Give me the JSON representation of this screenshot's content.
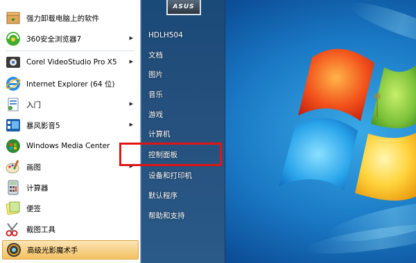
{
  "left_pane": {
    "items": [
      {
        "label": "强力卸载电脑上的软件",
        "icon": "uninstall-box-icon",
        "has_arrow": false
      },
      {
        "label": "360安全浏览器7",
        "icon": "browser-360-icon",
        "has_arrow": true
      },
      {
        "label": "Corel VideoStudio Pro X5",
        "icon": "corel-videostudio-icon",
        "has_arrow": true
      },
      {
        "label": "Internet Explorer (64 位)",
        "icon": "internet-explorer-icon",
        "has_arrow": false
      },
      {
        "label": "入门",
        "icon": "getting-started-icon",
        "has_arrow": true
      },
      {
        "label": "暴风影音5",
        "icon": "baofeng-player-icon",
        "has_arrow": true
      },
      {
        "label": "Windows Media Center",
        "icon": "windows-media-center-icon",
        "has_arrow": false
      },
      {
        "label": "画图",
        "icon": "paint-icon",
        "has_arrow": true
      },
      {
        "label": "计算器",
        "icon": "calculator-icon",
        "has_arrow": false
      },
      {
        "label": "便签",
        "icon": "sticky-notes-icon",
        "has_arrow": false
      },
      {
        "label": "截图工具",
        "icon": "snipping-tool-icon",
        "has_arrow": false
      },
      {
        "label": "高级光影魔术手",
        "icon": "nEO-imaging-icon",
        "has_arrow": false,
        "highlighted": true
      }
    ]
  },
  "user_picture": {
    "brand_text": "ASUS"
  },
  "right_pane": {
    "items": [
      {
        "label": "HDLH504"
      },
      {
        "label": "文档"
      },
      {
        "label": "图片"
      },
      {
        "label": "音乐"
      },
      {
        "label": "游戏"
      },
      {
        "label": "计算机"
      },
      {
        "label": "控制面板"
      },
      {
        "label": "设备和打印机"
      },
      {
        "label": "默认程序"
      },
      {
        "label": "帮助和支持"
      }
    ]
  },
  "annotation": {
    "color": "#e11414",
    "target": "控制面板"
  },
  "colors": {
    "desktop_blue": "#1a78c4",
    "right_pane": "#254f7c",
    "highlight": "#f4c062"
  }
}
